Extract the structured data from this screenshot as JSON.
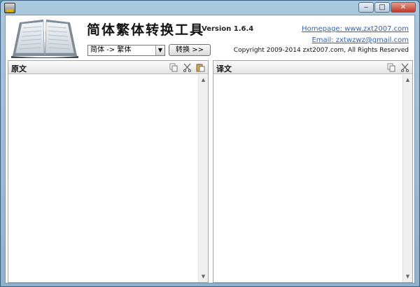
{
  "window": {
    "buttons": {
      "minimize": "‒",
      "maximize": "□",
      "close": "✕"
    }
  },
  "header": {
    "app_title": "简体繁体转换工具",
    "version": "Version 1.6.4",
    "direction_value": "简体 -> 繁体",
    "convert_label": "转换 >>",
    "homepage": "Homepage: www.zxt2007.com",
    "email": "Email: zxtwzwz@gmail.com",
    "copyright": "Copyright 2009-2014 zxt2007.com, All Rights Reserved"
  },
  "panels": {
    "source_title": "原文",
    "target_title": "译文"
  },
  "icons": {
    "copy": "copy-icon",
    "cut": "cut-icon",
    "paste": "paste-icon"
  }
}
